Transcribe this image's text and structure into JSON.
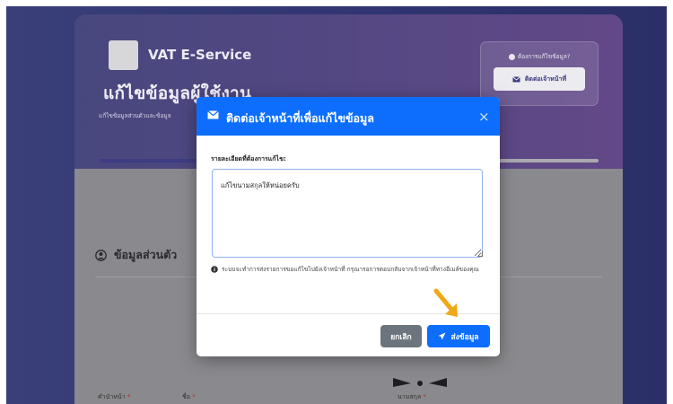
{
  "app": {
    "brand": "VAT E-Service",
    "page_title": "แก้ไขข้อมูลผู้ใช้งาน",
    "page_subtitle": "แก้ไขข้อมูลส่วนตัวและข้อมูล"
  },
  "help": {
    "text": "ต้องการแก้ไขข้อมูล?",
    "button_label": "ติดต่อเจ้าหน้าที่"
  },
  "progress": {
    "value": 0.24
  },
  "section": {
    "title": "ข้อมูลส่วนตัว"
  },
  "form_labels": {
    "prefix": "คำนำหน้า",
    "first_name": "ชื่อ",
    "last_name": "นามสกุล",
    "required_mark": "*"
  },
  "modal": {
    "title": "ติดต่อเจ้าหน้าที่เพื่อแก้ไขข้อมูล",
    "close": "×",
    "field_label": "รายละเอียดที่ต้องการแก้ไข:",
    "textarea_value": "แก้ไขนามสกุลให้หน่อยครับ",
    "info": "ระบบจะทำการส่งรายการขอแก้ไขไปยังเจ้าหน้าที่ กรุณารอการตอบกลับจากเจ้าหน้าที่ทางอีเมล์ของคุณ",
    "cancel_label": "ยกเลิก",
    "send_label": "ส่งข้อมูล"
  },
  "colors": {
    "primary": "#0d6efd",
    "secondary": "#6c757d",
    "header_purple": "#4a3b80",
    "arrow": "#f0a818"
  },
  "icons": [
    "mail-icon",
    "info-icon",
    "user-circle-icon",
    "send-icon",
    "close-icon"
  ]
}
